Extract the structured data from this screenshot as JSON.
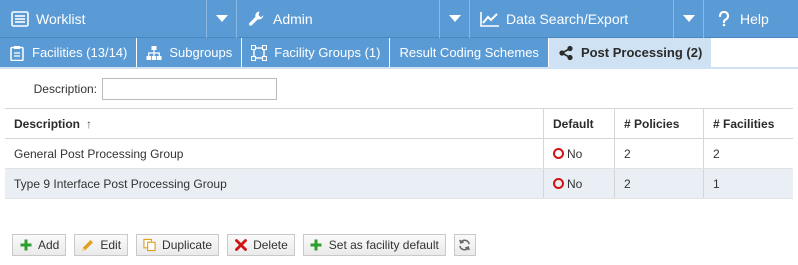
{
  "nav": {
    "worklist": {
      "label": "Worklist",
      "icon": "list-icon"
    },
    "admin": {
      "label": "Admin",
      "icon": "wrench-icon"
    },
    "data": {
      "label": "Data Search/Export",
      "icon": "chart-icon"
    },
    "help": {
      "label": "Help",
      "icon": "question-icon"
    }
  },
  "tabs": [
    {
      "label": "Facilities (13/14)",
      "icon": "clipboard-icon",
      "active": false
    },
    {
      "label": "Subgroups",
      "icon": "hierarchy-icon",
      "active": false
    },
    {
      "label": "Facility Groups (1)",
      "icon": "frame-icon",
      "active": false
    },
    {
      "label": "Result Coding Schemes",
      "icon": "",
      "active": false
    },
    {
      "label": "Post Processing (2)",
      "icon": "share-icon",
      "active": true
    }
  ],
  "filter": {
    "label": "Description:",
    "value": ""
  },
  "grid": {
    "columns": [
      "Description",
      "Default",
      "# Policies",
      "# Facilities"
    ],
    "sort_indicator": "↑",
    "rows": [
      {
        "description": "General Post Processing Group",
        "default": "No",
        "policies": "2",
        "facilities": "2"
      },
      {
        "description": "Type 9 Interface Post Processing Group",
        "default": "No",
        "policies": "2",
        "facilities": "1"
      }
    ]
  },
  "toolbar": {
    "add": "Add",
    "edit": "Edit",
    "duplicate": "Duplicate",
    "delete": "Delete",
    "set_default": "Set as facility default"
  },
  "colors": {
    "nav_bg": "#5b9bd5",
    "tab_active_bg": "#cfe2f3",
    "row_alt_bg": "#e9eff5",
    "no_icon": "#d01414",
    "add_icon": "#2e9e2e",
    "delete_icon": "#d01414",
    "edit_icon": "#e0a020"
  }
}
